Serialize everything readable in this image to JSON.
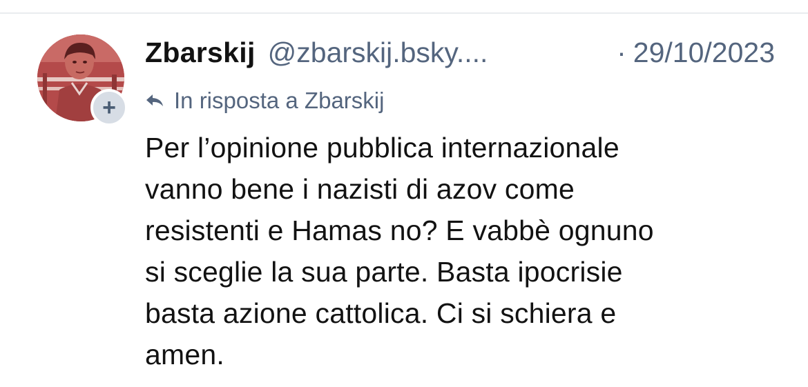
{
  "post": {
    "author": {
      "display_name": "Zbarskij",
      "handle": "@zbarskij.bsky....",
      "follow_icon": "plus-icon"
    },
    "timestamp_separator": "·",
    "date": "29/10/2023",
    "reply_context": {
      "icon": "reply-arrow-icon",
      "text": "In risposta a Zbarskij"
    },
    "body_lines": [
      "Per l’opinione pubblica internazionale",
      "vanno bene i nazisti di azov come",
      "resistenti e Hamas no? E vabbè ognuno",
      "si sceglie la sua parte. Basta ipocrisie",
      "basta azione cattolica. Ci si schiera e",
      "amen."
    ]
  },
  "colors": {
    "text_primary": "#121212",
    "text_secondary": "#54657e",
    "divider": "#e9ecef",
    "badge_bg": "#d7dde5",
    "avatar_tint": "#b64b4b"
  }
}
